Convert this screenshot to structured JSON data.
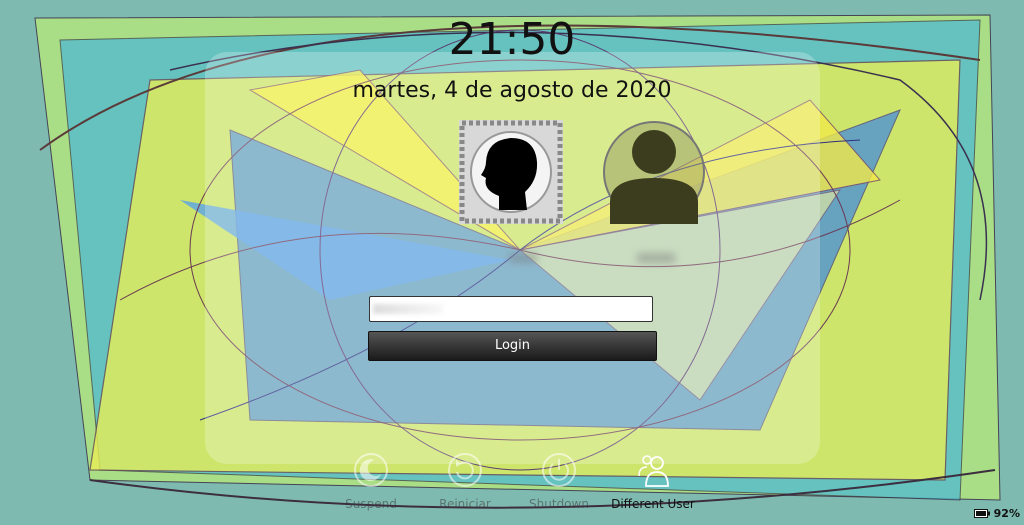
{
  "clock": {
    "time": "21:50",
    "date": "martes, 4 de agosto de 2020"
  },
  "users": [
    {
      "avatar": "head-silhouette-avatar"
    },
    {
      "avatar": "generic-user-avatar"
    }
  ],
  "login": {
    "password_placeholder": "",
    "button_label": "Login"
  },
  "actions": [
    {
      "label": "Suspend",
      "icon": "suspend-icon"
    },
    {
      "label": "Reiniciar",
      "icon": "restart-icon"
    },
    {
      "label": "Shutdown",
      "icon": "shutdown-icon"
    },
    {
      "label": "Different User",
      "icon": "switch-user-icon"
    }
  ],
  "status": {
    "battery": "92%",
    "icon": "battery-icon"
  },
  "colors": {
    "background": "#7fbab0",
    "button": "#2a2a2a"
  }
}
